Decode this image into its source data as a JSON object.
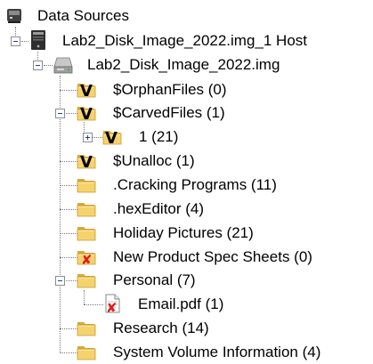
{
  "tree": {
    "root": {
      "label": "Data Sources",
      "icon": "data-sources-icon"
    },
    "host": {
      "label": "Lab2_Disk_Image_2022.img_1 Host",
      "icon": "host-computer-icon"
    },
    "image": {
      "label": "Lab2_Disk_Image_2022.img",
      "icon": "disk-image-icon"
    },
    "items": [
      {
        "label": "$OrphanFiles (0)",
        "icon": "virtual-folder-icon"
      },
      {
        "label": "$CarvedFiles (1)",
        "icon": "virtual-folder-icon",
        "expanded": true
      },
      {
        "label": "1 (21)",
        "icon": "virtual-folder-icon",
        "expanded": false
      },
      {
        "label": "$Unalloc (1)",
        "icon": "virtual-folder-icon"
      },
      {
        "label": ".Cracking Programs (11)",
        "icon": "folder-icon"
      },
      {
        "label": ".hexEditor (4)",
        "icon": "folder-icon"
      },
      {
        "label": "Holiday Pictures (21)",
        "icon": "folder-icon"
      },
      {
        "label": "New Product Spec Sheets (0)",
        "icon": "deleted-folder-icon"
      },
      {
        "label": "Personal (7)",
        "icon": "folder-icon",
        "expanded": true
      },
      {
        "label": "Email.pdf (1)",
        "icon": "deleted-file-icon"
      },
      {
        "label": "Research (14)",
        "icon": "folder-icon"
      },
      {
        "label": "System Volume Information (4)",
        "icon": "folder-icon"
      }
    ]
  },
  "colors": {
    "folder": "#f5d36c",
    "folder_dark": "#d7a93a",
    "tree_line": "#7a7a7a",
    "expander_sign": "#1f3f9f",
    "deleted_x": "#e21a1a"
  }
}
